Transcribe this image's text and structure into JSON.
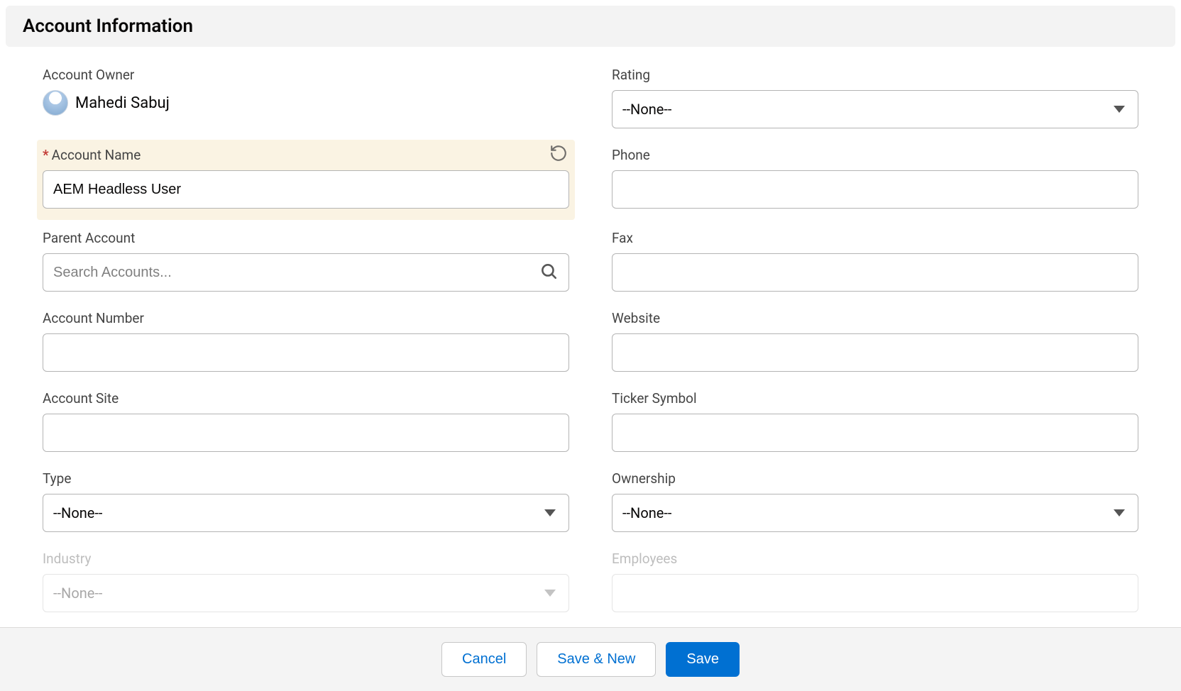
{
  "section_title": "Account Information",
  "left": {
    "owner_label": "Account Owner",
    "owner_name": "Mahedi Sabuj",
    "account_name_label": "Account Name",
    "account_name_value": "AEM Headless User",
    "parent_account_label": "Parent Account",
    "parent_account_placeholder": "Search Accounts...",
    "account_number_label": "Account Number",
    "account_number_value": "",
    "account_site_label": "Account Site",
    "account_site_value": "",
    "type_label": "Type",
    "type_value": "--None--",
    "industry_label": "Industry",
    "industry_value": "--None--"
  },
  "right": {
    "rating_label": "Rating",
    "rating_value": "--None--",
    "phone_label": "Phone",
    "phone_value": "",
    "fax_label": "Fax",
    "fax_value": "",
    "website_label": "Website",
    "website_value": "",
    "ticker_label": "Ticker Symbol",
    "ticker_value": "",
    "ownership_label": "Ownership",
    "ownership_value": "--None--",
    "employees_label": "Employees",
    "employees_value": ""
  },
  "footer": {
    "cancel": "Cancel",
    "save_new": "Save & New",
    "save": "Save"
  }
}
